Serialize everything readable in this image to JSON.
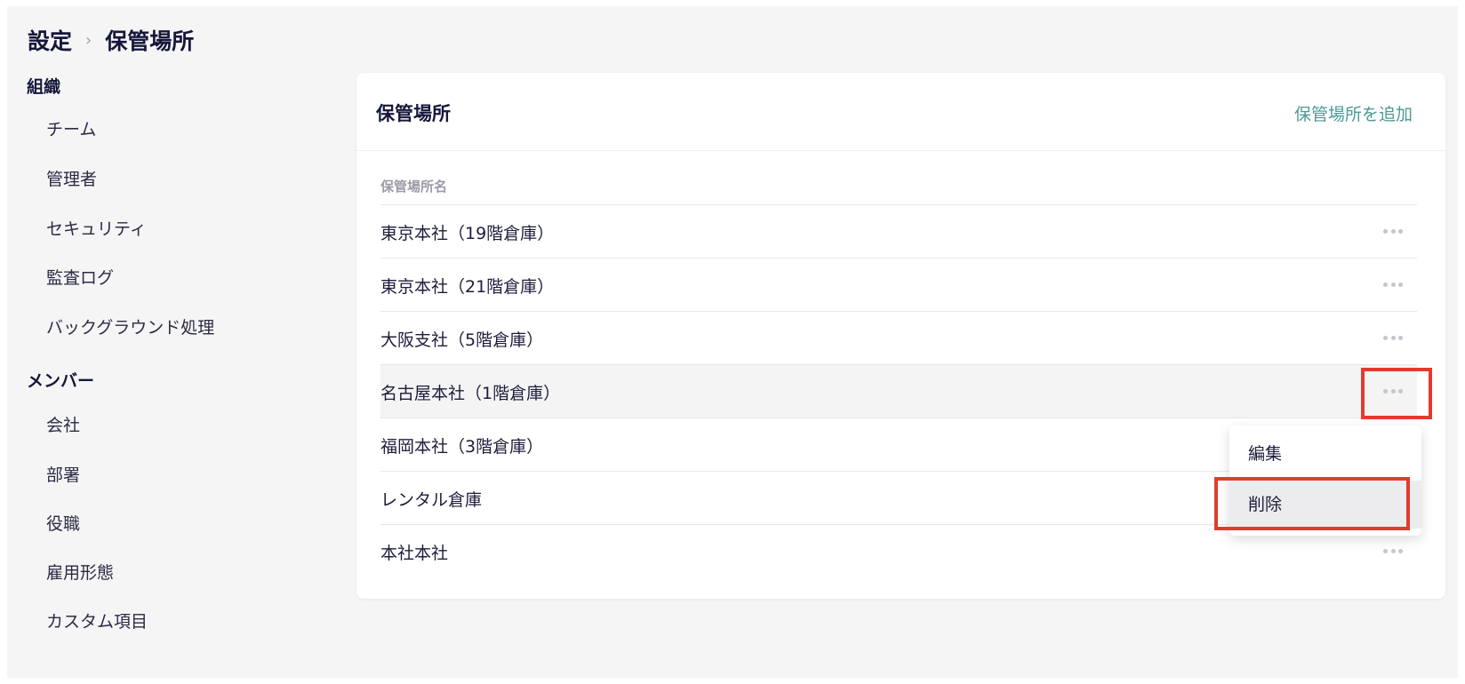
{
  "breadcrumb": {
    "parent": "設定",
    "separator": "›",
    "current": "保管場所"
  },
  "sidebar": {
    "sections": [
      {
        "title": "組織",
        "items": [
          "チーム",
          "管理者",
          "セキュリティ",
          "監査ログ",
          "バックグラウンド処理"
        ]
      },
      {
        "title": "メンバー",
        "items": [
          "会社",
          "部署",
          "役職",
          "雇用形態",
          "カスタム項目"
        ]
      }
    ]
  },
  "card": {
    "title": "保管場所",
    "add_label": "保管場所を追加",
    "column_header": "保管場所名",
    "rows": [
      "東京本社（19階倉庫）",
      "東京本社（21階倉庫）",
      "大阪支社（5階倉庫）",
      "名古屋本社（1階倉庫）",
      "福岡本社（3階倉庫）",
      "レンタル倉庫",
      "本社本社"
    ]
  },
  "context_menu": {
    "items": [
      "編集",
      "削除"
    ]
  },
  "colors": {
    "accent": "#4a9a96",
    "highlight": "#e23b2e",
    "page_bg": "#f5f5f5"
  }
}
